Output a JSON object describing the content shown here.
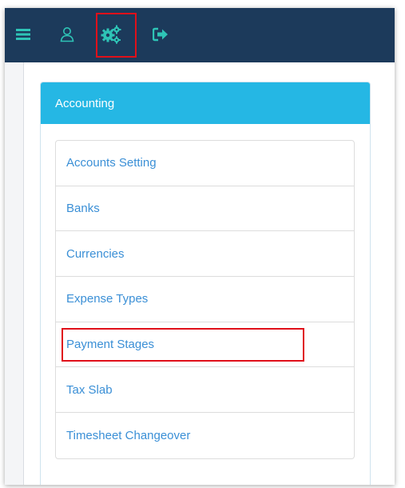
{
  "nav": {
    "icons": [
      "menu-icon",
      "user-icon",
      "settings-cogs-icon",
      "logout-icon"
    ],
    "icon_color": "#2ec4b6"
  },
  "panel": {
    "title": "Accounting",
    "heading_color": "#25b7e4",
    "items": [
      {
        "label": "Accounts Setting"
      },
      {
        "label": "Banks"
      },
      {
        "label": "Currencies"
      },
      {
        "label": "Expense Types"
      },
      {
        "label": "Payment Stages"
      },
      {
        "label": "Tax Slab"
      },
      {
        "label": "Timesheet Changeover"
      }
    ]
  },
  "highlights": {
    "color": "#e0101a",
    "targets": [
      "settings-cogs-icon",
      "Payment Stages"
    ]
  }
}
